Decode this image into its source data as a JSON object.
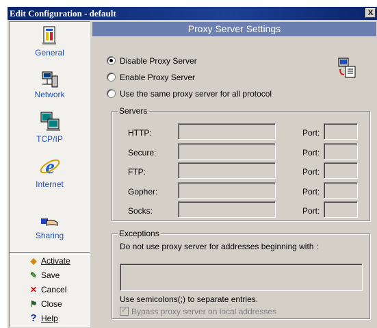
{
  "window": {
    "title": "Edit Configuration - default",
    "close_label": "X"
  },
  "sidebar": {
    "items": [
      {
        "label": "General"
      },
      {
        "label": "Network"
      },
      {
        "label": "TCP/IP"
      },
      {
        "label": "Internet"
      },
      {
        "label": "Sharing"
      }
    ],
    "actions": [
      {
        "label": "Activate",
        "icon": "activate-icon"
      },
      {
        "label": "Save",
        "icon": "save-icon"
      },
      {
        "label": "Cancel",
        "icon": "cancel-icon"
      },
      {
        "label": "Close",
        "icon": "close-icon"
      },
      {
        "label": "Help",
        "icon": "help-icon"
      }
    ]
  },
  "main": {
    "header": "Proxy Server Settings",
    "options": [
      {
        "label": "Disable Proxy Server",
        "selected": true
      },
      {
        "label": "Enable Proxy Server",
        "selected": false
      },
      {
        "label": "Use the same proxy server for all protocol",
        "selected": false
      }
    ],
    "servers": {
      "legend": "Servers",
      "port_label": "Port:",
      "rows": [
        {
          "label": "HTTP:",
          "value": "",
          "port": ""
        },
        {
          "label": "Secure:",
          "value": "",
          "port": ""
        },
        {
          "label": "FTP:",
          "value": "",
          "port": ""
        },
        {
          "label": "Gopher:",
          "value": "",
          "port": ""
        },
        {
          "label": "Socks:",
          "value": "",
          "port": ""
        }
      ]
    },
    "exceptions": {
      "legend": "Exceptions",
      "description": "Do not use proxy server for addresses beginning with :",
      "value": "",
      "hint": "Use semicolons(;) to separate entries.",
      "bypass_label": "Bypass proxy server on local addresses",
      "bypass_checked": true
    }
  },
  "colors": {
    "title_bar": "#0a246a",
    "header": "#6b7fb0",
    "nav_label": "#1d52c5",
    "dialog_bg": "#d4d0c8"
  }
}
